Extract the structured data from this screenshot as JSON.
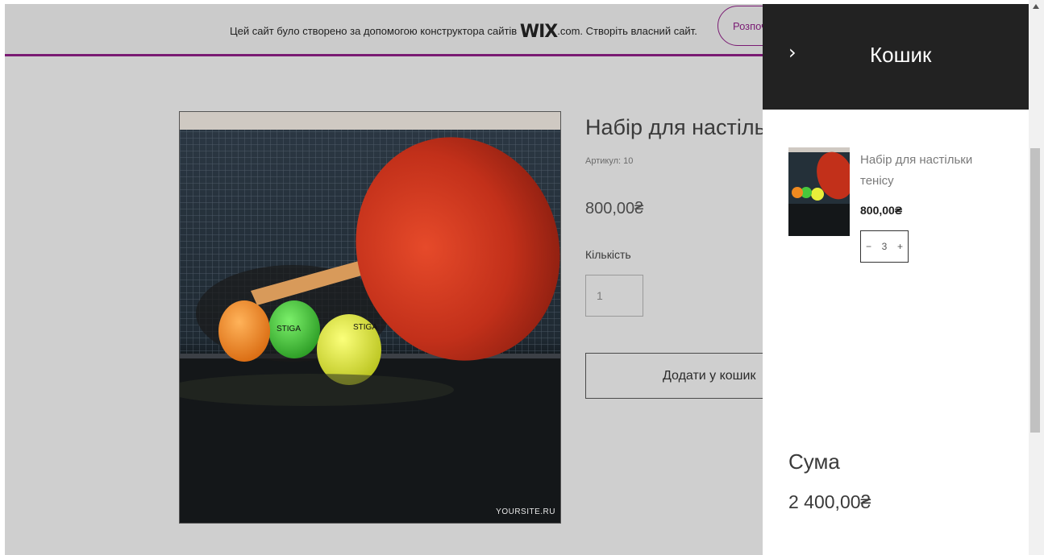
{
  "banner": {
    "text_before": "Цей сайт було створено за допомогою конструктора сайтів ",
    "brand": "WIX",
    "text_after": ".com. Створіть власний сайт.",
    "button_label": "Розпочати"
  },
  "product": {
    "title": "Набір для настільного тенісу",
    "sku": "Артикул: 10",
    "price": "800,00₴",
    "quantity_label": "Кількість",
    "quantity_value": "1",
    "add_to_cart_label": "Додати у кошик",
    "image_watermark": "YOURSITE.RU"
  },
  "cart": {
    "close_icon": "chevron-right-icon",
    "title": "Кошик",
    "item": {
      "name": "Набір для настільки тенісу",
      "price": "800,00₴",
      "decrement": "−",
      "quantity": "3",
      "increment": "+"
    },
    "sum_label": "Сума",
    "sum_value": "2 400,00₴"
  },
  "colors": {
    "accent": "#7a1b73",
    "cart_header": "#222222",
    "overlay_page": "#cfcfcf"
  }
}
